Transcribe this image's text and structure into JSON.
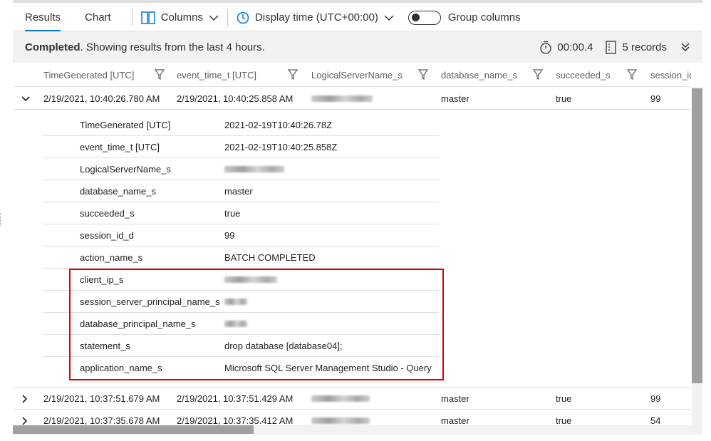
{
  "toolbar": {
    "tabs": [
      "Results",
      "Chart"
    ],
    "columns_label": "Columns",
    "display_time_label": "Display time (UTC+00:00)",
    "group_columns_label": "Group columns"
  },
  "status": {
    "bold": "Completed",
    "text": ". Showing results from the last 4 hours.",
    "duration": "00:00.4",
    "records": "5 records"
  },
  "columns": [
    "TimeGenerated [UTC]",
    "event_time_t [UTC]",
    "LogicalServerName_s",
    "database_name_s",
    "succeeded_s",
    "session_id_d"
  ],
  "rows": [
    {
      "time_generated": "2/19/2021, 10:40:26.780 AM",
      "event_time": "2/19/2021, 10:40:25.858 AM",
      "database": "master",
      "succeeded": "true",
      "session": "99"
    },
    {
      "time_generated": "2/19/2021, 10:37:51.679 AM",
      "event_time": "2/19/2021, 10:37:51.429 AM",
      "database": "master",
      "succeeded": "true",
      "session": "99"
    },
    {
      "time_generated": "2/19/2021, 10:37:35.678 AM",
      "event_time": "2/19/2021, 10:37:35.412 AM",
      "database": "master",
      "succeeded": "true",
      "session": "54"
    }
  ],
  "detail": [
    {
      "key": "TimeGenerated [UTC]",
      "value": "2021-02-19T10:40:26.78Z"
    },
    {
      "key": "event_time_t [UTC]",
      "value": "2021-02-19T10:40:25.858Z"
    },
    {
      "key": "LogicalServerName_s",
      "value": ""
    },
    {
      "key": "database_name_s",
      "value": "master"
    },
    {
      "key": "succeeded_s",
      "value": "true"
    },
    {
      "key": "session_id_d",
      "value": "99"
    },
    {
      "key": "action_name_s",
      "value": "BATCH COMPLETED"
    },
    {
      "key": "client_ip_s",
      "value": ""
    },
    {
      "key": "session_server_principal_name_s",
      "value": ""
    },
    {
      "key": "database_principal_name_s",
      "value": ""
    },
    {
      "key": "statement_s",
      "value": "drop database [database04];"
    },
    {
      "key": "application_name_s",
      "value": "Microsoft SQL Server Management Studio - Query"
    }
  ],
  "colors": {
    "accent": "#0078d4",
    "highlight": "#e00000"
  }
}
